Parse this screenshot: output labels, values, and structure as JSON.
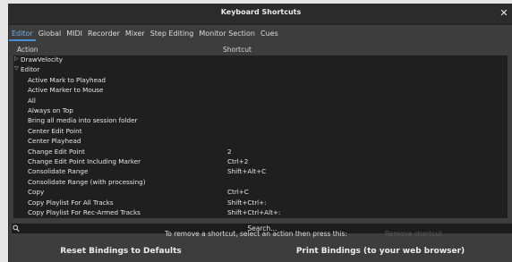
{
  "window": {
    "title": "Keyboard Shortcuts",
    "close_glyph": "✕"
  },
  "tabs": [
    {
      "label": "Editor",
      "active": true
    },
    {
      "label": "Global"
    },
    {
      "label": "MIDI"
    },
    {
      "label": "Recorder"
    },
    {
      "label": "Mixer"
    },
    {
      "label": "Step Editing"
    },
    {
      "label": "Monitor Section"
    },
    {
      "label": "Cues"
    }
  ],
  "columns": {
    "action": "Action",
    "shortcut": "Shortcut"
  },
  "rows": [
    {
      "action": "DrawVelocity",
      "shortcut": "",
      "expander": "▷",
      "level": 0
    },
    {
      "action": "Editor",
      "shortcut": "",
      "expander": "▽",
      "level": 0
    },
    {
      "action": "Active Mark to Playhead",
      "shortcut": "",
      "level": 1
    },
    {
      "action": "Active Marker to Mouse",
      "shortcut": "",
      "level": 1
    },
    {
      "action": "All",
      "shortcut": "",
      "level": 1
    },
    {
      "action": "Always on Top",
      "shortcut": "",
      "level": 1
    },
    {
      "action": "Bring all media into session folder",
      "shortcut": "",
      "level": 1
    },
    {
      "action": "Center Edit Point",
      "shortcut": "",
      "level": 1
    },
    {
      "action": "Center Playhead",
      "shortcut": "",
      "level": 1
    },
    {
      "action": "Change Edit Point",
      "shortcut": "2",
      "level": 1
    },
    {
      "action": "Change Edit Point Including Marker",
      "shortcut": "Ctrl+2",
      "level": 1
    },
    {
      "action": "Consolidate Range",
      "shortcut": "Shift+Alt+C",
      "level": 1
    },
    {
      "action": "Consolidate Range (with processing)",
      "shortcut": "",
      "level": 1
    },
    {
      "action": "Copy",
      "shortcut": "Ctrl+C",
      "level": 1
    },
    {
      "action": "Copy Playlist For All Tracks",
      "shortcut": "Shift+Ctrl+:",
      "level": 1
    },
    {
      "action": "Copy Playlist For Rec-Armed Tracks",
      "shortcut": "Shift+Ctrl+Alt+:",
      "level": 1
    }
  ],
  "search": {
    "placeholder": "Search...",
    "icon": "search-icon"
  },
  "hint": "To remove a shortcut, select an action then press this:",
  "hint_ghost": "Remove shortcut",
  "buttons": {
    "reset": "Reset Bindings to Defaults",
    "print": "Print Bindings (to your web browser)"
  },
  "colors": {
    "window_bg": "#3d3d3d",
    "list_bg": "#1f1f1f",
    "accent": "#4a8fd0"
  }
}
